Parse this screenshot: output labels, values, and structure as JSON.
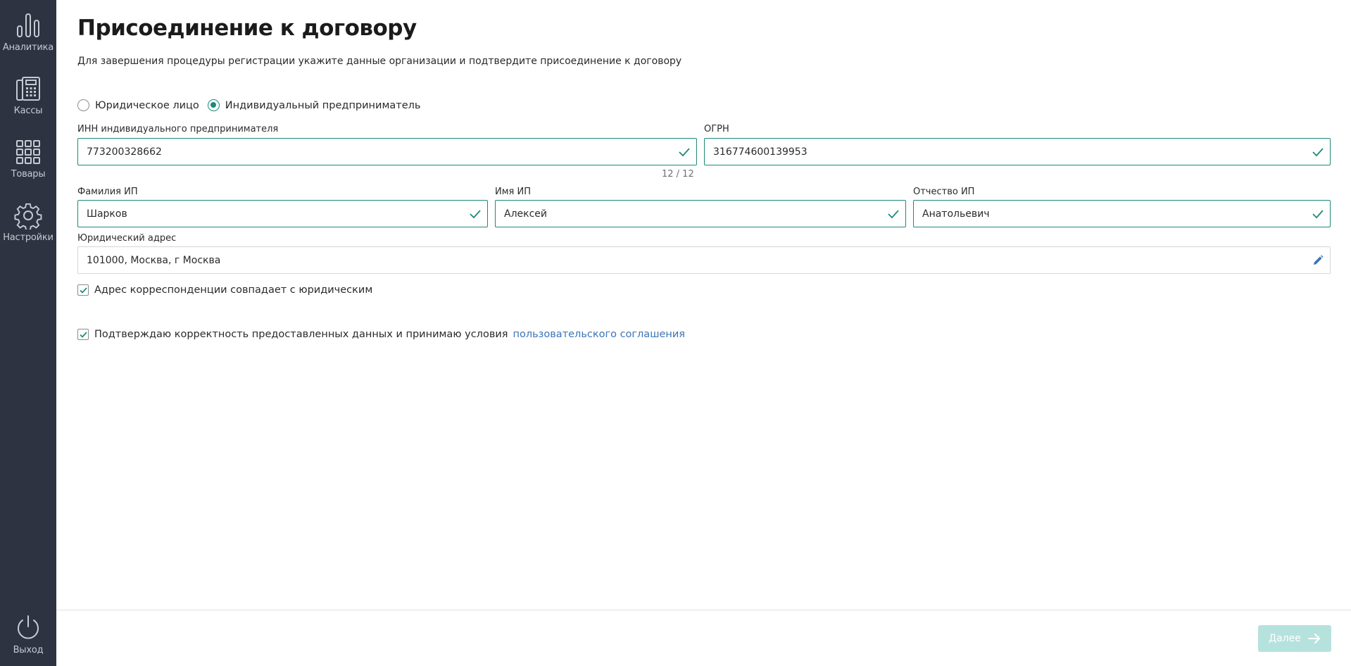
{
  "sidebar": {
    "items": [
      {
        "label": "Аналитика",
        "icon": "bar-chart-icon"
      },
      {
        "label": "Кассы",
        "icon": "cash-register-icon"
      },
      {
        "label": "Товары",
        "icon": "grid-icon"
      },
      {
        "label": "Настройки",
        "icon": "gear-icon"
      }
    ],
    "exit": {
      "label": "Выход",
      "icon": "power-icon"
    }
  },
  "page": {
    "title": "Присоединение к договору",
    "subtitle": "Для завершения процедуры регистрации укажите данные организации и подтвердите присоединение к договору"
  },
  "entity_type": {
    "options": [
      {
        "label": "Юридическое лицо",
        "selected": false
      },
      {
        "label": "Индивидуальный предприниматель",
        "selected": true
      }
    ]
  },
  "form": {
    "inn": {
      "label": "ИНН индивидуального предпринимателя",
      "value": "773200328662",
      "counter": "12 / 12"
    },
    "ogrn": {
      "label": "ОГРН",
      "value": "316774600139953"
    },
    "last_name": {
      "label": "Фамилия ИП",
      "value": "Шарков"
    },
    "first_name": {
      "label": "Имя ИП",
      "value": "Алексей"
    },
    "middle_name": {
      "label": "Отчество ИП",
      "value": "Анатольевич"
    },
    "address": {
      "label": "Юридический адрес",
      "value": "101000, Москва, г Москва"
    },
    "same_address": {
      "label": "Адрес корреспонденции совпадает с юридическим",
      "checked": true
    },
    "agreement": {
      "label": "Подтверждаю корректность предоставленных данных и принимаю условия",
      "link": "пользовательского соглашения",
      "checked": true
    }
  },
  "footer": {
    "next_label": "Далее"
  },
  "colors": {
    "sidebar": "#2d3340",
    "accent": "#1c8a78",
    "link": "#3a74b8",
    "button_disabled": "#b6e2de"
  }
}
